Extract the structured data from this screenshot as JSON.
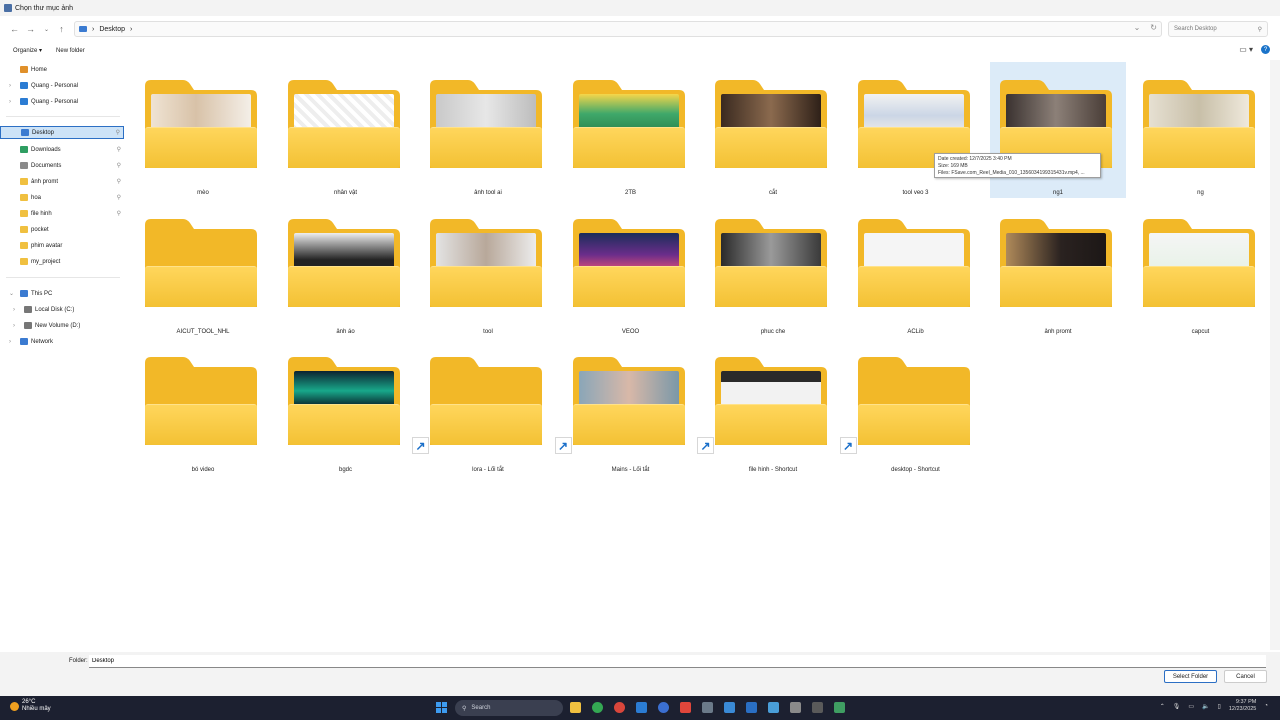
{
  "window": {
    "title": "Chọn thư mục ảnh"
  },
  "address": {
    "path": [
      "Desktop"
    ],
    "search_placeholder": "Search Desktop"
  },
  "commands": {
    "organize": "Organize",
    "new_folder": "New folder"
  },
  "sidebar": {
    "items": [
      {
        "label": "Home",
        "icon": "home-icon",
        "color": "#e0902a"
      },
      {
        "label": "Quang - Personal",
        "icon": "onedrive-icon",
        "color": "#2b7cd3"
      },
      {
        "label": "Quang - Personal",
        "icon": "onedrive-icon",
        "color": "#2b7cd3"
      },
      {
        "label": "Desktop",
        "icon": "desktop-icon",
        "color": "#3b7bd1",
        "selected": true
      },
      {
        "label": "Downloads",
        "icon": "download-icon",
        "color": "#2f9e62"
      },
      {
        "label": "Documents",
        "icon": "document-icon",
        "color": "#8a8a8a"
      },
      {
        "label": "ảnh promt",
        "icon": "folder-icon",
        "color": "#f0c040"
      },
      {
        "label": "hoa",
        "icon": "folder-icon",
        "color": "#f0c040"
      },
      {
        "label": "file hinh",
        "icon": "folder-icon",
        "color": "#f0c040"
      },
      {
        "label": "pocket",
        "icon": "folder-icon",
        "color": "#f0c040"
      },
      {
        "label": "phim avatar",
        "icon": "folder-icon",
        "color": "#f0c040"
      },
      {
        "label": "my_project",
        "icon": "folder-icon",
        "color": "#f0c040"
      },
      {
        "label": "This PC",
        "icon": "pc-icon",
        "color": "#3b7bd1"
      },
      {
        "label": "Local Disk (C:)",
        "icon": "drive-icon",
        "color": "#777"
      },
      {
        "label": "New Volume (D:)",
        "icon": "drive-icon",
        "color": "#777"
      },
      {
        "label": "Network",
        "icon": "network-icon",
        "color": "#3b7bd1"
      }
    ]
  },
  "folders": [
    {
      "name": "mèo",
      "thumb": "linear-gradient(90deg,#efe3d3,#d8c2a8 45%,#f4efe8)"
    },
    {
      "name": "nhân vật",
      "thumb": "repeating-linear-gradient(45deg,#eee 0 4px,#fff 4px 8px)"
    },
    {
      "name": "ảnh tool ai",
      "thumb": "linear-gradient(90deg,#c9c9c9,#e7e7e7 50%,#bdbdbd)"
    },
    {
      "name": "2TB",
      "thumb": "linear-gradient(180deg,#f6d64a,#3fa86a 55%,#2d8a52)"
    },
    {
      "name": "cắt",
      "thumb": "linear-gradient(90deg,#3a2a20,#8b6a4e 50%,#2e2018)"
    },
    {
      "name": "tool veo 3",
      "thumb": "linear-gradient(180deg,#f2f2f2,#cbd6e6 60%,#e8e8e8)"
    },
    {
      "name": "ng1",
      "thumb": "linear-gradient(90deg,#3a3230,#8c8078 50%,#4a3e38)"
    },
    {
      "name": "ng",
      "thumb": "linear-gradient(90deg,#e6e0d2,#c8bfa8 50%,#efe9dc)"
    },
    {
      "name": "AICUT_TOOL_NHL",
      "thumb": ""
    },
    {
      "name": "ảnh áo",
      "thumb": "linear-gradient(180deg,#eeeeee,#222 75%)"
    },
    {
      "name": "tool",
      "thumb": "linear-gradient(90deg,#e3e3e3,#b8a89a 50%,#ececec)"
    },
    {
      "name": "VEOO",
      "thumb": "linear-gradient(180deg,#1b2d5a,#6a2d8a 60%,#d04a7a)"
    },
    {
      "name": "phuc che",
      "thumb": "linear-gradient(90deg,#2a2a2a,#9a9a9a 50%,#3a3a3a)"
    },
    {
      "name": "ACLib",
      "thumb": "linear-gradient(180deg,#f5f5f5,#f5f5f5)"
    },
    {
      "name": "ảnh promt",
      "thumb": "linear-gradient(90deg,#b08a5a,#2a2220 55%,#1c1716)"
    },
    {
      "name": "capcut",
      "thumb": "linear-gradient(180deg,#f5f5f5,#e8f2e8)"
    },
    {
      "name": "bó video",
      "thumb": ""
    },
    {
      "name": "bgdc",
      "thumb": "linear-gradient(180deg,#0c2230,#18a88a 55%,#0a1c26)"
    },
    {
      "name": "lora - Lối tắt",
      "thumb": "",
      "shortcut": true
    },
    {
      "name": "Mains - Lối tắt",
      "thumb": "linear-gradient(90deg,#8aa6b8,#d8b8a8 50%,#7a98a8)",
      "shortcut": true
    },
    {
      "name": "file hinh - Shortcut",
      "thumb": "linear-gradient(180deg,#2a2a2a 0 30%,#f2f2f2 30%)",
      "shortcut": true
    },
    {
      "name": "desktop - Shortcut",
      "thumb": "",
      "shortcut": true
    }
  ],
  "tooltip": {
    "date_created": "Date created: 12/7/2025 3:40 PM",
    "size": "Size: 169 MB",
    "files": "Files: FSave.com_Reel_Media_010_1356034199315431v.mp4, ..."
  },
  "footer": {
    "folder_label": "Folder:",
    "folder_value": "Desktop",
    "select_button": "Select Folder",
    "cancel_button": "Cancel"
  },
  "taskbar": {
    "temperature": "26°C",
    "weather": "Nhiều mây",
    "search": "Search",
    "time": "9:37 PM",
    "date": "12/23/2025"
  }
}
